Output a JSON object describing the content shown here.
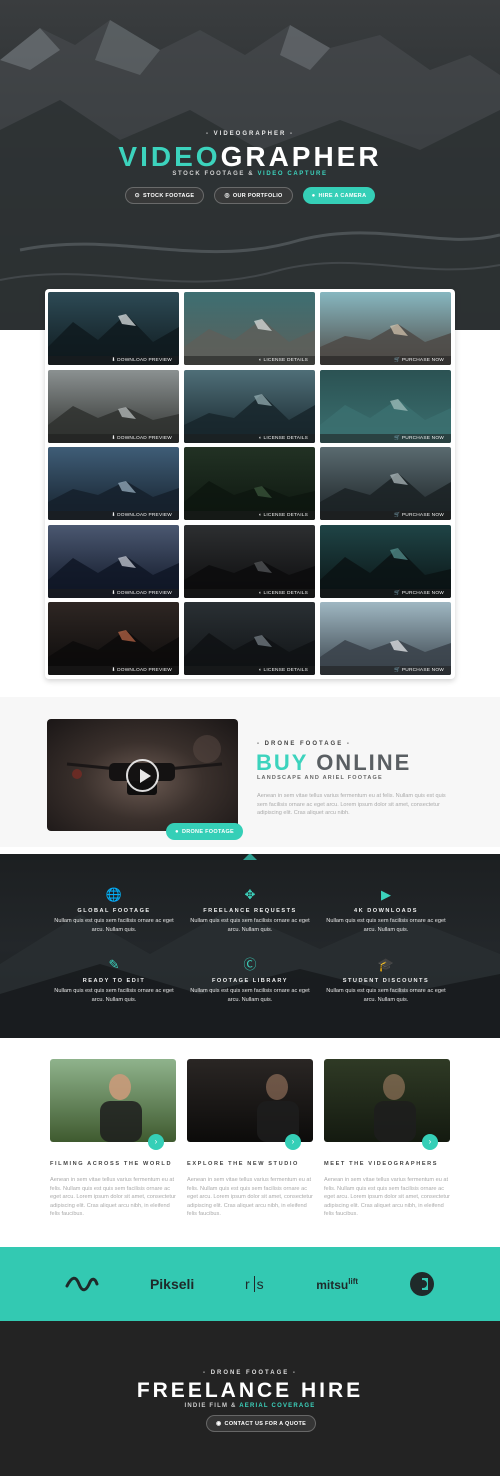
{
  "colors": {
    "accent": "#3cd3bd",
    "teal_bg": "#33c9b2",
    "dark": "#232323"
  },
  "hero": {
    "overline": "- VIDEOGRAPHER -",
    "title_accent": "VIDEO",
    "title_rest": "GRAPHER",
    "subtitle_main": "STOCK FOOTAGE &",
    "subtitle_accent": "VIDEO CAPTURE",
    "buttons": [
      {
        "label": "STOCK FOOTAGE",
        "icon": "map-pin-icon"
      },
      {
        "label": "OUR PORTFOLIO",
        "icon": "compass-icon"
      },
      {
        "label": "HIRE A CAMERA",
        "icon": "circle-icon"
      }
    ]
  },
  "gallery": {
    "tiles": [
      {
        "label": "DOWNLOAD PREVIEW",
        "icon": "download-icon",
        "scene": "dark-mountains"
      },
      {
        "label": "LICENSE DETAILS",
        "icon": "license-icon",
        "scene": "snow-peaks"
      },
      {
        "label": "PURCHASE NOW",
        "icon": "cart-icon",
        "scene": "building"
      },
      {
        "label": "DOWNLOAD PREVIEW",
        "icon": "download-icon",
        "scene": "valley"
      },
      {
        "label": "LICENSE DETAILS",
        "icon": "license-icon",
        "scene": "waves"
      },
      {
        "label": "PURCHASE NOW",
        "icon": "cart-icon",
        "scene": "sea-wave"
      },
      {
        "label": "DOWNLOAD PREVIEW",
        "icon": "download-icon",
        "scene": "skyscrapers"
      },
      {
        "label": "LICENSE DETAILS",
        "icon": "license-icon",
        "scene": "forest"
      },
      {
        "label": "PURCHASE NOW",
        "icon": "cart-icon",
        "scene": "sea-stack"
      },
      {
        "label": "DOWNLOAD PREVIEW",
        "icon": "download-icon",
        "scene": "ocean-sunset"
      },
      {
        "label": "LICENSE DETAILS",
        "icon": "license-icon",
        "scene": "dark-water"
      },
      {
        "label": "PURCHASE NOW",
        "icon": "cart-icon",
        "scene": "lake-forest"
      },
      {
        "label": "DOWNLOAD PREVIEW",
        "icon": "download-icon",
        "scene": "sea-cave"
      },
      {
        "label": "LICENSE DETAILS",
        "icon": "license-icon",
        "scene": "pier"
      },
      {
        "label": "PURCHASE NOW",
        "icon": "cart-icon",
        "scene": "cloud-mountain"
      }
    ]
  },
  "buy": {
    "overline": "- DRONE FOOTAGE -",
    "title_accent": "BUY",
    "title_rest": "ONLINE",
    "subtitle": "LANDSCAPE AND ARIEL FOOTAGE",
    "paragraph": "Aenean in sem vitae tellus varius fermentum eu at felis. Nullam quis est quis sem facilisis ornare ac eget arcu. Lorem ipsum dolor sit amet, consectetur adipiscing elit. Cras aliquet arcu nibh.",
    "video_button": "DRONE FOOTAGE"
  },
  "features": [
    {
      "title": "GLOBAL FOOTAGE",
      "text": "Nullam quis est quis sem facilisis ornare ac eget arcu. Nullam quis.",
      "icon": "globe-icon"
    },
    {
      "title": "FREELANCE REQUESTS",
      "text": "Nullam quis est quis sem facilisis ornare ac eget arcu. Nullam quis.",
      "icon": "crosshair-icon"
    },
    {
      "title": "4K DOWNLOADS",
      "text": "Nullam quis est quis sem facilisis ornare ac eget arcu. Nullam quis.",
      "icon": "play-circle-icon"
    },
    {
      "title": "READY TO EDIT",
      "text": "Nullam quis est quis sem facilisis ornare ac eget arcu. Nullam quis.",
      "icon": "edit-icon"
    },
    {
      "title": "FOOTAGE LIBRARY",
      "text": "Nullam quis est quis sem facilisis ornare ac eget arcu. Nullam quis.",
      "icon": "cc-icon"
    },
    {
      "title": "STUDENT DISCOUNTS",
      "text": "Nullam quis est quis sem facilisis ornare ac eget arcu. Nullam quis.",
      "icon": "graduation-cap-icon"
    }
  ],
  "team": [
    {
      "title": "FILMING ACROSS THE WORLD",
      "text": "Aenean in sem vitae tellus varius fermentum eu at felis. Nullam quis est quis sem facilisis ornare ac eget arcu. Lorem ipsum dolor sit amet, consectetur adipiscing elit. Cras aliquet arcu nibh, in eleifend felis faucibus."
    },
    {
      "title": "EXPLORE THE NEW STUDIO",
      "text": "Aenean in sem vitae tellus varius fermentum eu at felis. Nullam quis est quis sem facilisis ornare ac eget arcu. Lorem ipsum dolor sit amet, consectetur adipiscing elit. Cras aliquet arcu nibh, in eleifend felis faucibus."
    },
    {
      "title": "MEET THE VIDEOGRAPHERS",
      "text": "Aenean in sem vitae tellus varius fermentum eu at felis. Nullam quis est quis sem facilisis ornare ac eget arcu. Lorem ipsum dolor sit amet, consectetur adipiscing elit. Cras aliquet arcu nibh, in eleifend felis faucibus."
    }
  ],
  "logos": {
    "pikseli": "Pikseli",
    "rs_a": "r",
    "rs_b": "s",
    "mitsu": "mitsu",
    "lift": "lift"
  },
  "footer": {
    "overline": "- DRONE FOOTAGE -",
    "title": "FREELANCE HIRE",
    "subtitle_main": "INDIE FILM &",
    "subtitle_accent": "AERIAL COVERAGE",
    "cta": "CONTACT US FOR A QUOTE"
  }
}
